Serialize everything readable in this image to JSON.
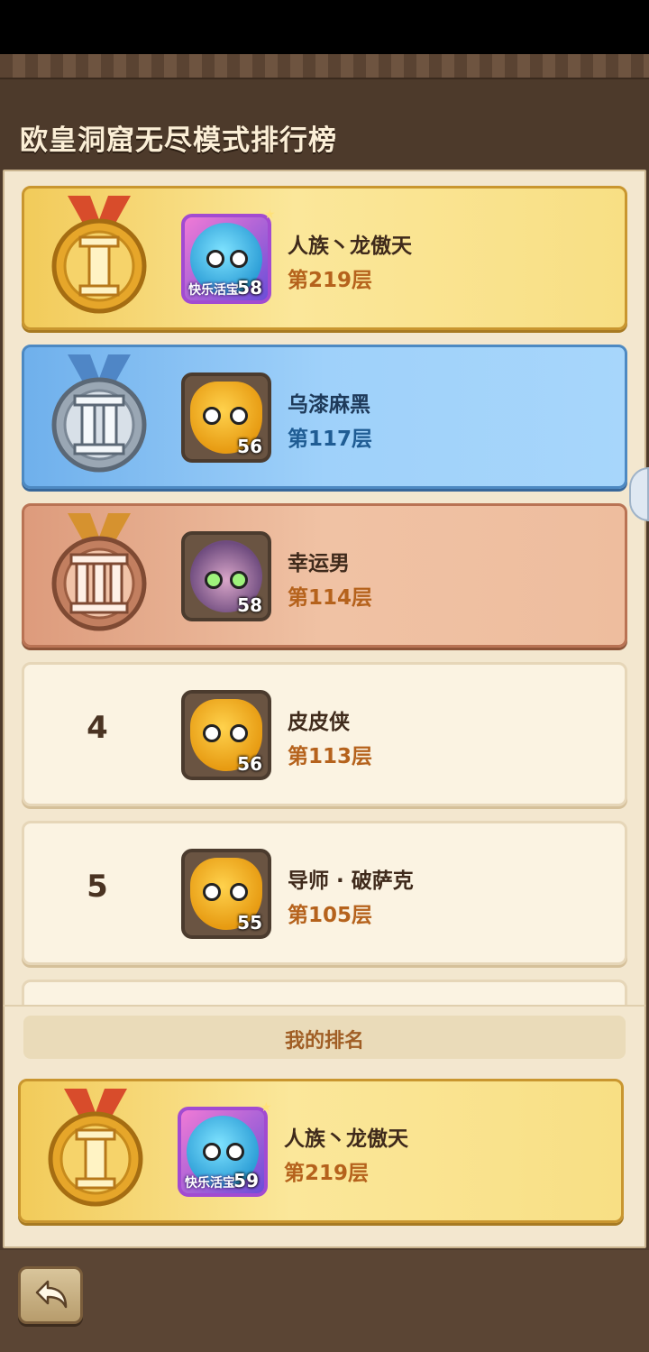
{
  "page": {
    "title": "欧皇洞窟无尽模式排行榜"
  },
  "leaderboard": {
    "rows": [
      {
        "rank": "1",
        "medal": "gold-medal-I",
        "name": "人族丶龙傲天",
        "floor": "第219层",
        "avatar_level": "58",
        "avatar_tag": "快乐活宝",
        "avatar_icon": "blue-elf-avatar-icon"
      },
      {
        "rank": "2",
        "medal": "silver-medal-II",
        "name": "乌漆麻黑",
        "floor": "第117层",
        "avatar_level": "56",
        "avatar_icon": "orange-creature-avatar-icon"
      },
      {
        "rank": "3",
        "medal": "bronze-medal-III",
        "name": "幸运男",
        "floor": "第114层",
        "avatar_level": "58",
        "avatar_icon": "elf-warrior-avatar-icon"
      },
      {
        "rank": "4",
        "name": "皮皮侠",
        "floor": "第113层",
        "avatar_level": "56",
        "avatar_icon": "orange-creature-avatar-icon"
      },
      {
        "rank": "5",
        "name": "导师 · 破萨克",
        "floor": "第105层",
        "avatar_level": "55",
        "avatar_icon": "orange-creature-avatar-icon"
      }
    ]
  },
  "my_rank": {
    "label": "我的排名",
    "name": "人族丶龙傲天",
    "floor": "第219层",
    "avatar_level": "59",
    "avatar_tag": "快乐活宝",
    "medal": "gold-medal-I"
  },
  "colors": {
    "gold": "#f2cb5a",
    "silver": "#9fd1fa",
    "bronze": "#f0c2a4",
    "plain": "#fbf3e2",
    "floor_text": "#b5621c"
  }
}
